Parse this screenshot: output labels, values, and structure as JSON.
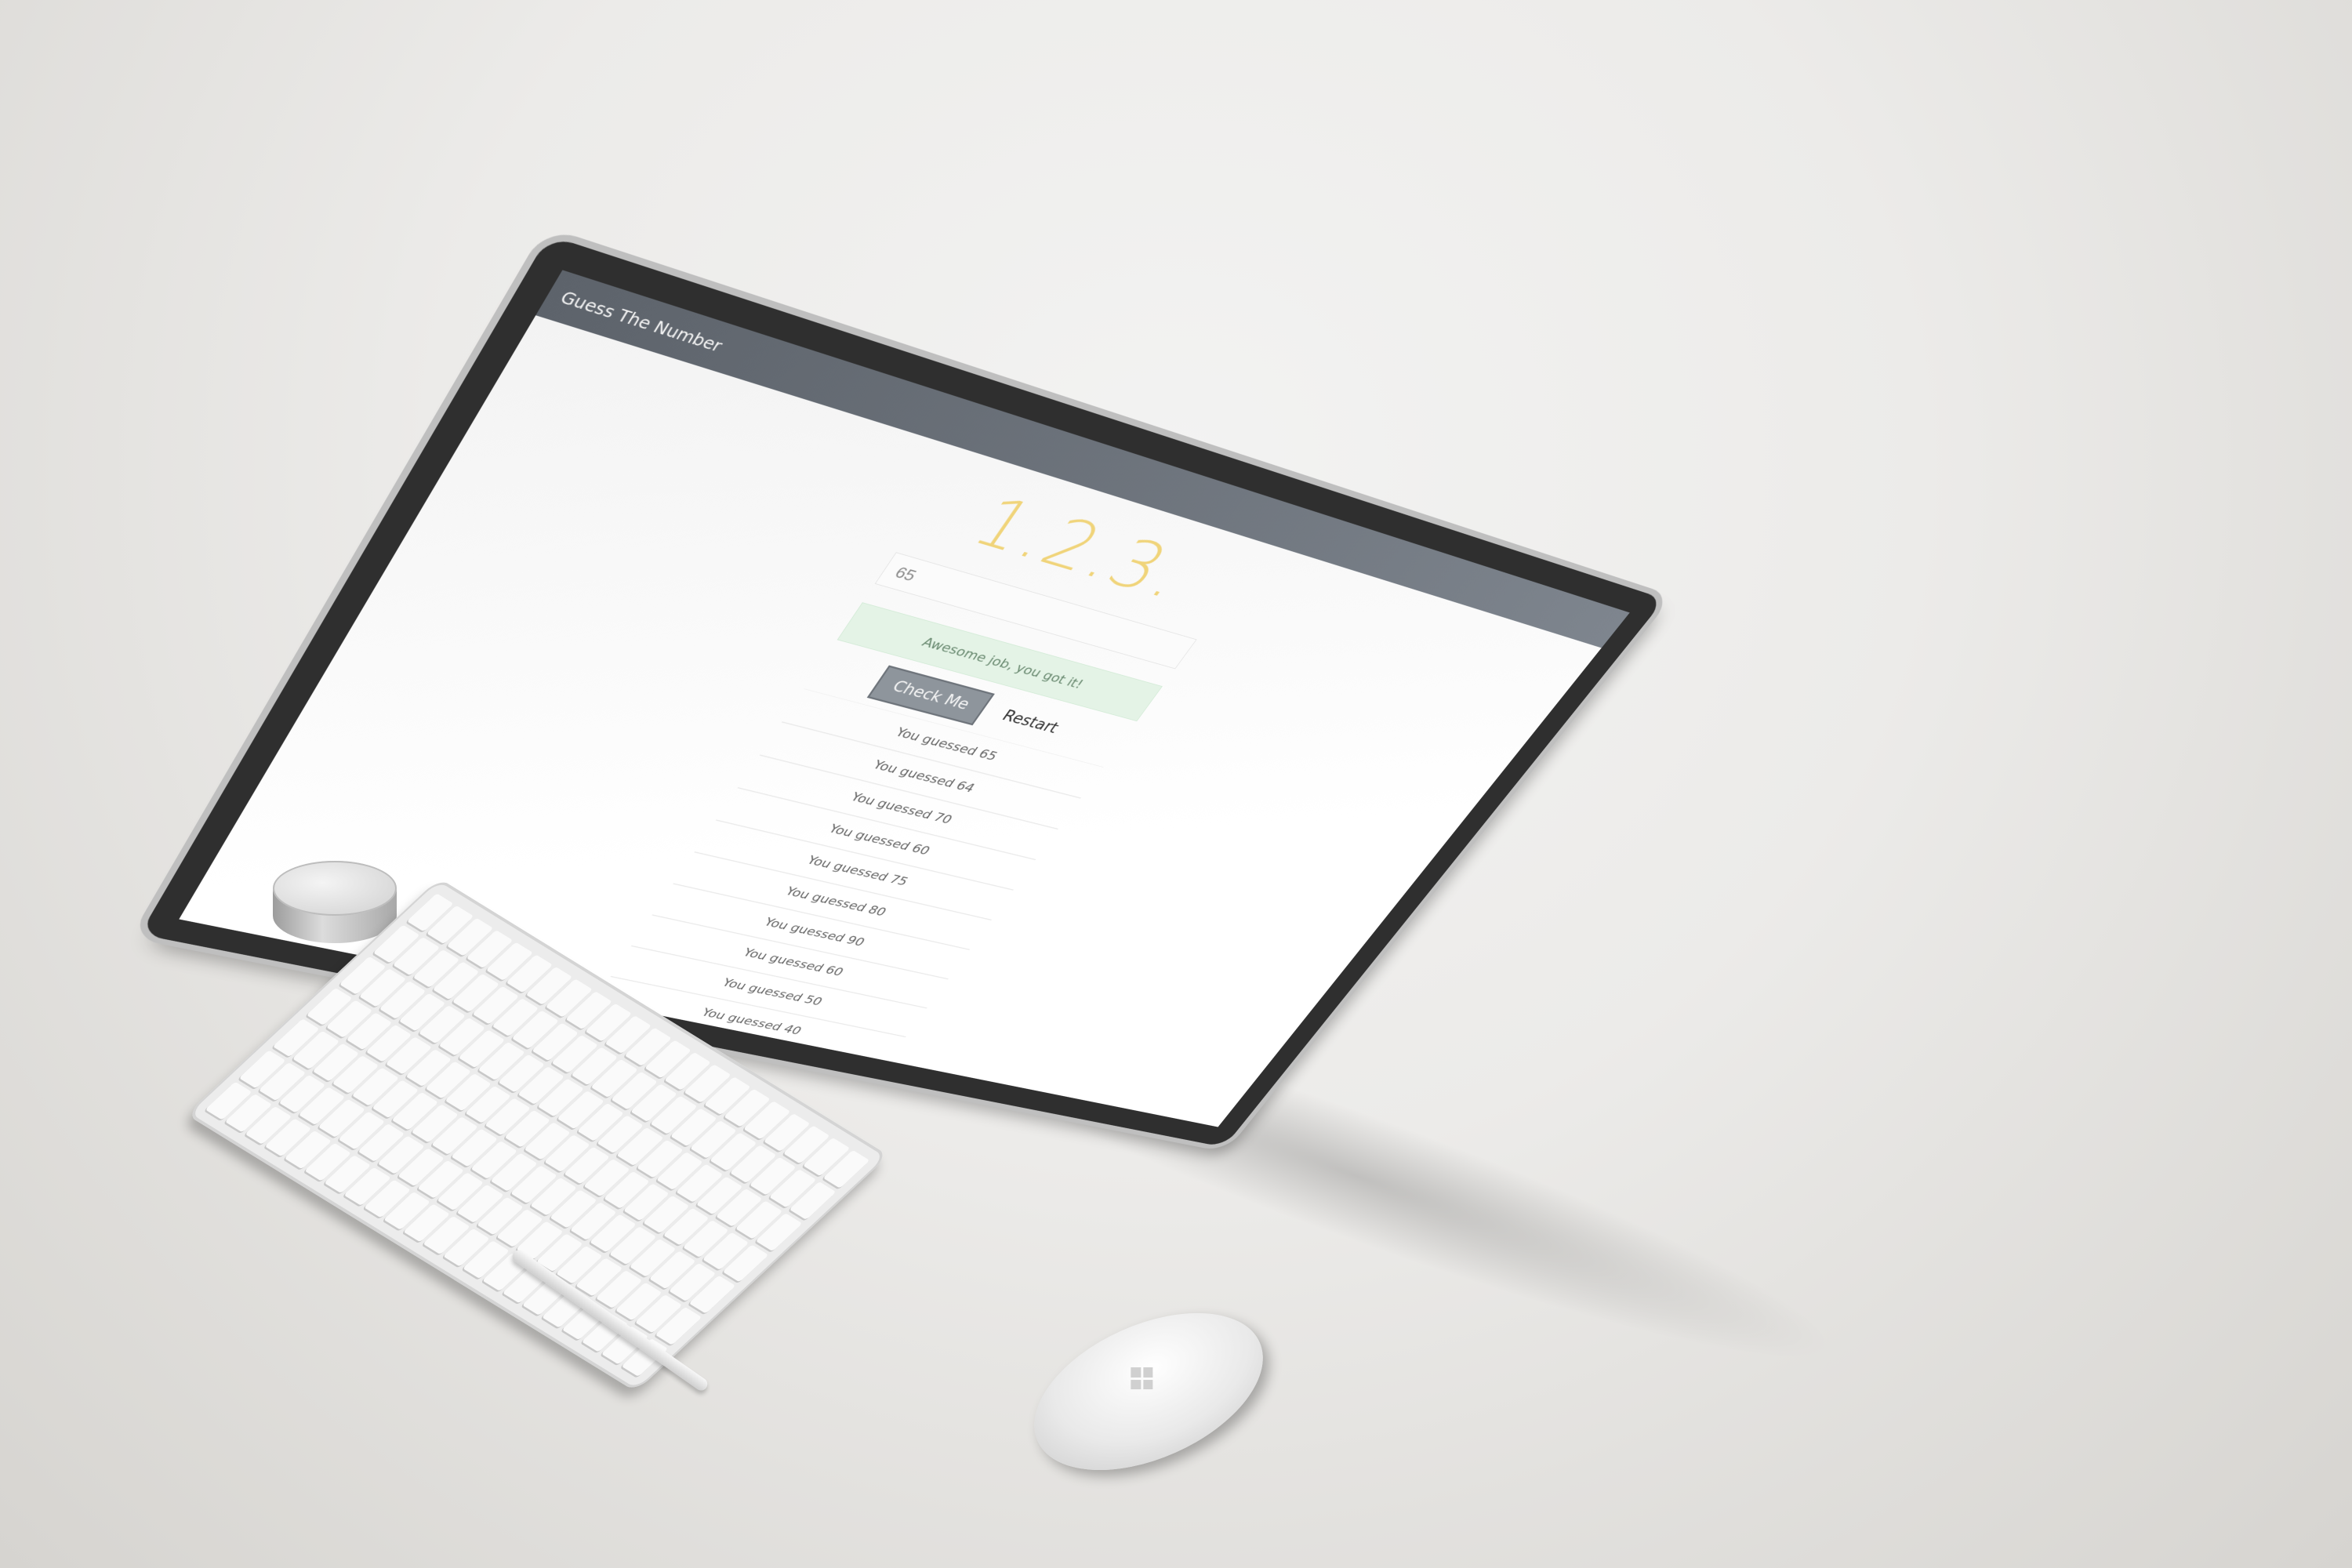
{
  "app": {
    "window_title": "Guess The Number",
    "logo_text": "1.2.3.",
    "input_value": "65",
    "feedback_message": "Awesome job, you got it!",
    "buttons": {
      "check_label": "Check Me",
      "restart_label": "Restart"
    },
    "history": [
      "You guessed 65",
      "You guessed 64",
      "You guessed 70",
      "You guessed 60",
      "You guessed 75",
      "You guessed 80",
      "You guessed 90",
      "You guessed 60",
      "You guessed 50",
      "You guessed 40"
    ]
  },
  "colors": {
    "titlebar": "#6c727a",
    "logo": "#f0d47a",
    "feedback_bg": "#e4f3e6",
    "check_button": "#8e959c"
  },
  "icons": {
    "mouse_logo": "windows-logo-icon"
  }
}
